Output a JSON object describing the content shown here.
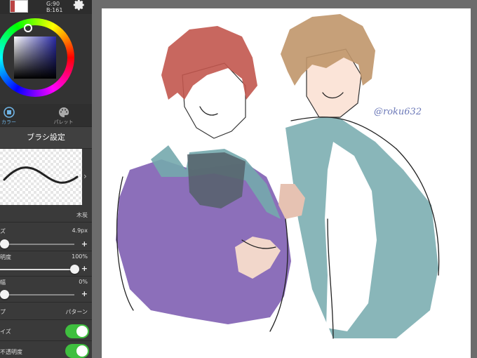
{
  "color": {
    "g_label": "G:90",
    "b_label": "B:161",
    "current_hex": "#2a2aa6"
  },
  "tabs": [
    {
      "label": "カラー",
      "icon": "color-icon",
      "active": true
    },
    {
      "label": "パレット",
      "icon": "palette-icon",
      "active": false
    }
  ],
  "brush": {
    "section_title": "ブラシ設定",
    "name": "木炭",
    "size_label": "ズ",
    "size_value": "4.9px",
    "size_fraction": 0.05,
    "opacity_label": "明度",
    "opacity_value": "100%",
    "opacity_fraction": 1.0,
    "third_label": "幅",
    "third_value": "0%",
    "third_fraction": 0.0,
    "type_label": "プ",
    "type_value": "パターン",
    "toggle1_label": "イズ",
    "toggle1_on": true,
    "toggle2_label": "不透明度",
    "toggle2_on": true
  },
  "canvas": {
    "signature": "@roku632"
  }
}
